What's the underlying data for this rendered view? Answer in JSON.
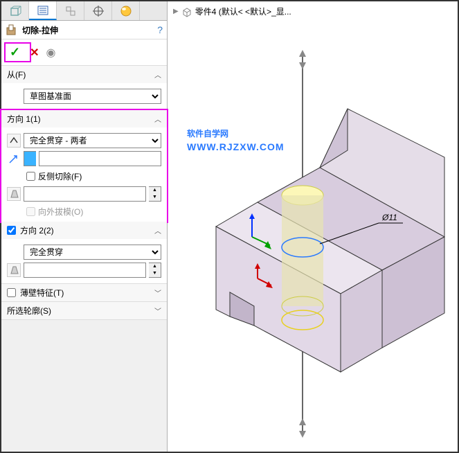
{
  "feature": {
    "title": "切除-拉伸",
    "help": "?"
  },
  "sections": {
    "from": {
      "title": "从(F)",
      "plane": "草图基准面"
    },
    "dir1": {
      "title": "方向 1(1)",
      "end_condition": "完全贯穿 - 两者",
      "depth_value": "",
      "reverse_cut": "反侧切除(F)",
      "draft_value": "",
      "draft_outward": "向外拔模(O)"
    },
    "dir2": {
      "title": "方向 2(2)",
      "end_condition": "完全贯穿",
      "draft_value": ""
    },
    "thin": {
      "title": "薄壁特征(T)"
    },
    "contours": {
      "title": "所选轮廓(S)"
    }
  },
  "tree": {
    "part": "零件4 (默认< <默认>_显..."
  },
  "watermark": {
    "line1": "软件自学网",
    "line2": "WWW.RJZXW.COM"
  },
  "dimension": "Ø11"
}
